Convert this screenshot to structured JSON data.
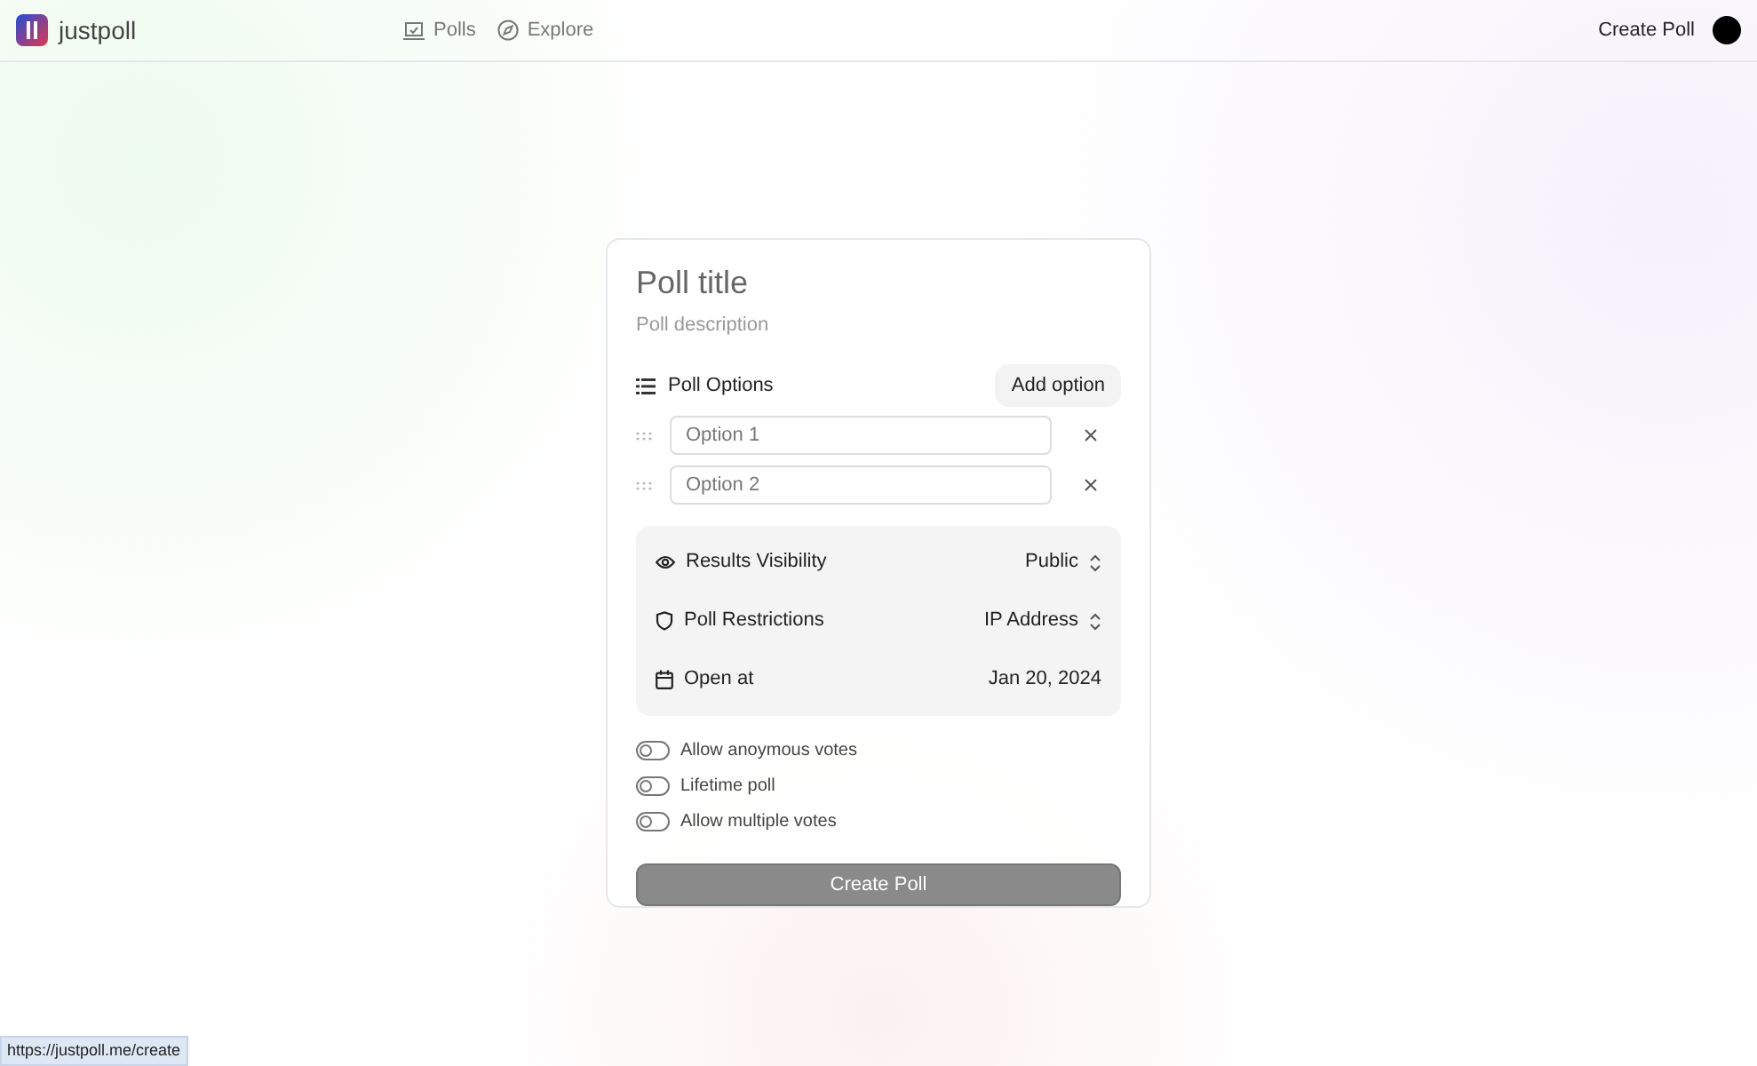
{
  "header": {
    "brand": "justpoll",
    "nav": [
      {
        "label": "Polls",
        "kind": "polls"
      },
      {
        "label": "Explore",
        "kind": "explore"
      }
    ],
    "create_link": "Create Poll"
  },
  "form": {
    "title_placeholder": "Poll title",
    "description_placeholder": "Poll description",
    "options_heading": "Poll Options",
    "add_option": "Add option",
    "options": [
      {
        "placeholder": "Option 1"
      },
      {
        "placeholder": "Option 2"
      }
    ],
    "settings": [
      {
        "kind": "visibility",
        "label": "Results Visibility",
        "value": "Public"
      },
      {
        "kind": "restrictions",
        "label": "Poll Restrictions",
        "value": "IP Address"
      },
      {
        "kind": "date",
        "label": "Open at",
        "value": "Jan 20, 2024"
      }
    ],
    "toggles": [
      {
        "label": "Allow anoymous votes",
        "on": false
      },
      {
        "label": "Lifetime poll",
        "on": false
      },
      {
        "label": "Allow multiple votes",
        "on": false
      }
    ],
    "submit": {
      "label": "Create Poll",
      "disabled": true
    }
  },
  "status_url": "https://justpoll.me/create"
}
